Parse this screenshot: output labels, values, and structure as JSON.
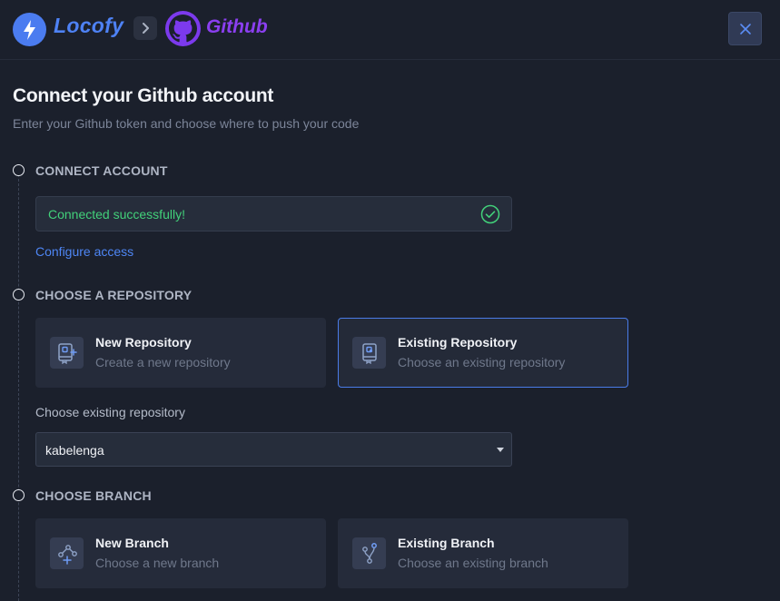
{
  "header": {
    "brand_name": "Locofy",
    "target_name": "Github"
  },
  "page": {
    "title": "Connect your Github account",
    "subtitle": "Enter your Github token and choose where to push your code"
  },
  "steps": {
    "connect": {
      "title": "CONNECT ACCOUNT",
      "status_text": "Connected successfully!",
      "configure_link": "Configure access"
    },
    "repository": {
      "title": "CHOOSE A REPOSITORY",
      "options": [
        {
          "title": "New Repository",
          "subtitle": "Create a new repository",
          "selected": false
        },
        {
          "title": "Existing Repository",
          "subtitle": "Choose an existing repository",
          "selected": true
        }
      ],
      "field_label": "Choose existing repository",
      "selected_value": "kabelenga"
    },
    "branch": {
      "title": "CHOOSE BRANCH",
      "options": [
        {
          "title": "New Branch",
          "subtitle": "Choose a new branch",
          "selected": false
        },
        {
          "title": "Existing Branch",
          "subtitle": "Choose an existing branch",
          "selected": false
        }
      ]
    }
  },
  "colors": {
    "background": "#1b202c",
    "accent_blue": "#4e86f5",
    "github_purple": "#7c3aed",
    "success_green": "#42d17a"
  },
  "icons": {
    "brand": "lightning-bolt-icon",
    "separator": "chevron-right-icon",
    "target": "github-icon",
    "close": "close-icon",
    "status": "check-circle-icon",
    "new_repo": "new-repository-icon",
    "existing_repo": "existing-repository-icon",
    "new_branch": "new-branch-icon",
    "existing_branch": "existing-branch-icon"
  }
}
